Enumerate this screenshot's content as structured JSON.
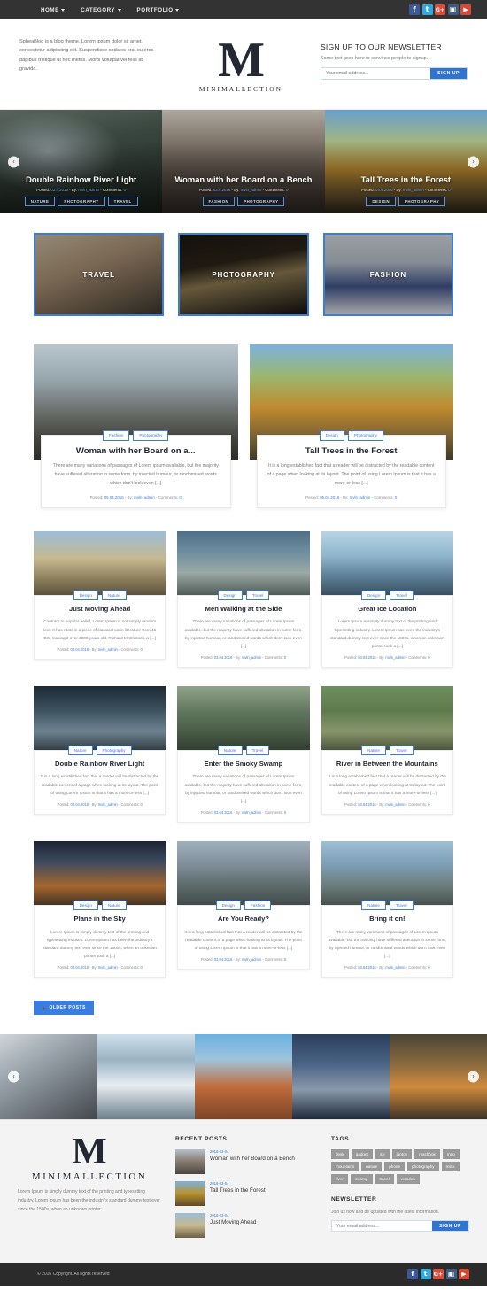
{
  "topnav": {
    "items": [
      {
        "label": "HOME",
        "icon": "chevron-down-icon"
      },
      {
        "label": "CATEGORY",
        "icon": "chevron-down-icon"
      },
      {
        "label": "PORTFOLIO",
        "icon": "chevron-down-icon"
      }
    ],
    "social": [
      {
        "name": "facebook-icon",
        "glyph": "f",
        "color": "#3b5998"
      },
      {
        "name": "twitter-icon",
        "glyph": "t",
        "color": "#2eaae0"
      },
      {
        "name": "google-plus-icon",
        "glyph": "G+",
        "color": "#dd4b39"
      },
      {
        "name": "instagram-icon",
        "glyph": "▣",
        "color": "#3f5d80"
      },
      {
        "name": "youtube-icon",
        "glyph": "▶",
        "color": "#d64937"
      }
    ]
  },
  "header": {
    "description": "SpheaBlog is a blog theme. Lorem ipsum dolor sit amet, consectetur adipiscing elit. Suspendisse sodales erat eu eros dapibus tristique ut nec metus. Morbi volutpat vel felis at gravida.",
    "brand_letter": "M",
    "brand_name": "MINIMALLECTION",
    "newsletter": {
      "title": "SIGN UP TO OUR NEWSLETTER",
      "subtitle": "Some text goes here to convince people to signup.",
      "placeholder": "Your email address...",
      "button": "SIGN UP"
    }
  },
  "slider": {
    "prev_icon": "‹",
    "next_icon": "›",
    "slides": [
      {
        "title": "Double Rainbow River Light",
        "meta_prefix": "Posted: ",
        "date": "03.4.2016",
        "by_prefix": " - By: ",
        "author": "mvln_admin",
        "comments_prefix": " - Comments: ",
        "comments": "0",
        "categories": [
          "NATURE",
          "PHOTOGRAPHY",
          "TRAVEL"
        ]
      },
      {
        "title": "Woman with her Board on a Bench",
        "meta_prefix": "Posted: ",
        "date": "03.4.2016",
        "by_prefix": " - By: ",
        "author": "mvln_admin",
        "comments_prefix": " - Comments: ",
        "comments": "0",
        "categories": [
          "FASHION",
          "PHOTOGRAPHY"
        ]
      },
      {
        "title": "Tall Trees in the Forest",
        "meta_prefix": "Posted: ",
        "date": "03.4.2016",
        "by_prefix": " - By: ",
        "author": "mvln_admin",
        "comments_prefix": " - Comments: ",
        "comments": "0",
        "categories": [
          "DESIGN",
          "PHOTOGRAPHY"
        ]
      }
    ]
  },
  "category_tiles": [
    {
      "label": "TRAVEL"
    },
    {
      "label": "PHOTOGRAPHY"
    },
    {
      "label": "FASHION"
    }
  ],
  "features": [
    {
      "chips": [
        "Fashion",
        "Photography"
      ],
      "title": "Woman with her Board on a...",
      "excerpt": "There are many variations of passages of Lorem ipsum available, but the majority have suffered alteration in some form, by injected humour, or randomised words which don't look even [...]",
      "meta_prefix": "Posted: ",
      "date": "05.04.2016",
      "by_prefix": " - By: ",
      "author": "mvln_admin",
      "comments_prefix": " - Comments: ",
      "comments": "0"
    },
    {
      "chips": [
        "Design",
        "Photography"
      ],
      "title": "Tall Trees in the Forest",
      "excerpt": "It is a long established fact that a reader will be distracted by the readable content of a page when looking at its layout. The point of using Lorem Ipsum is that it has a more-or-less [...]",
      "meta_prefix": "Posted: ",
      "date": "05.04.2016",
      "by_prefix": " - By: ",
      "author": "mvln_admin",
      "comments_prefix": " - Comments: ",
      "comments": "0"
    }
  ],
  "grid": [
    {
      "chips": [
        "Design",
        "Nature"
      ],
      "title": "Just Moving Ahead",
      "excerpt": "Contrary to popular belief, Lorem Ipsum is not simply random text. It has roots in a piece of classical Latin literature from 45 BC, making it over 2000 years old. Richard McClintock, a [...]",
      "meta_prefix": "Posted: ",
      "date": "03.04.2016",
      "by_prefix": " - By: ",
      "author": "mvln_admin",
      "comments_prefix": " - Comments: ",
      "comments": "0"
    },
    {
      "chips": [
        "Design",
        "Travel"
      ],
      "title": "Men Walking at the Side",
      "excerpt": "There are many variations of passages of Lorem Ipsum available, but the majority have suffered alteration in some form, by injected humour, or randomised words which don't look even [...]",
      "meta_prefix": "Posted: ",
      "date": "03.04.2016",
      "by_prefix": " - By: ",
      "author": "mvln_admin",
      "comments_prefix": " - Comments: ",
      "comments": "0"
    },
    {
      "chips": [
        "Design",
        "Travel"
      ],
      "title": "Great Ice Location",
      "excerpt": "Lorem Ipsum is simply dummy text of the printing and typesetting industry. Lorem Ipsum has been the industry's standard dummy text ever since the 1500s, when an unknown printer took a [...]",
      "meta_prefix": "Posted: ",
      "date": "03.04.2016",
      "by_prefix": " - By: ",
      "author": "mvln_admin",
      "comments_prefix": " - Comments: ",
      "comments": "0"
    },
    {
      "chips": [
        "Nature",
        "Photography"
      ],
      "title": "Double Rainbow River Light",
      "excerpt": "It is a long established fact that a reader will be distracted by the readable content of a page when looking at its layout. The point of using Lorem Ipsum is that it has a more-or-less [...]",
      "meta_prefix": "Posted: ",
      "date": "03.04.2016",
      "by_prefix": " - By: ",
      "author": "mvln_admin",
      "comments_prefix": " - Comments: ",
      "comments": "0"
    },
    {
      "chips": [
        "Nature",
        "Travel"
      ],
      "title": "Enter the Smoky Swamp",
      "excerpt": "There are many variations of passages of Lorem Ipsum available, but the majority have suffered alteration in some form, by injected humour, or randomised words which don't look even [...]",
      "meta_prefix": "Posted: ",
      "date": "03.04.2016",
      "by_prefix": " - By: ",
      "author": "mvln_admin",
      "comments_prefix": " - Comments: ",
      "comments": "0"
    },
    {
      "chips": [
        "Nature",
        "Travel"
      ],
      "title": "River in Between the Mountains",
      "excerpt": "It is a long established fact that a reader will be distracted by the readable content of a page when looking at its layout. The point of using Lorem Ipsum is that it has a more-or-less [...]",
      "meta_prefix": "Posted: ",
      "date": "03.04.2016",
      "by_prefix": " - By: ",
      "author": "mvln_admin",
      "comments_prefix": " - Comments: ",
      "comments": "0"
    },
    {
      "chips": [
        "Design",
        "Nature"
      ],
      "title": "Plane in the Sky",
      "excerpt": "Lorem Ipsum is simply dummy text of the printing and typesetting industry. Lorem Ipsum has been the industry's standard dummy text ever since the 1500s, when an unknown printer took a [...]",
      "meta_prefix": "Posted: ",
      "date": "03.04.2016",
      "by_prefix": " - By: ",
      "author": "mvln_admin",
      "comments_prefix": " - Comments: ",
      "comments": "0"
    },
    {
      "chips": [
        "Design",
        "Fashion"
      ],
      "title": "Are You Ready?",
      "excerpt": "It is a long established fact that a reader will be distracted by the readable content of a page when looking at its layout. The point of using Lorem Ipsum is that it has a more-or-less [...]",
      "meta_prefix": "Posted: ",
      "date": "03.04.2016",
      "by_prefix": " - By: ",
      "author": "mvln_admin",
      "comments_prefix": " - Comments: ",
      "comments": "0"
    },
    {
      "chips": [
        "Nature",
        "Travel"
      ],
      "title": "Bring it on!",
      "excerpt": "There are many variations of passages of Lorem Ipsum available, but the majority have suffered alteration in some form, by injected humour, or randomised words which don't look even [...]",
      "meta_prefix": "Posted: ",
      "date": "03.04.2016",
      "by_prefix": " - By: ",
      "author": "mvln_admin",
      "comments_prefix": " - Comments: ",
      "comments": "0"
    }
  ],
  "pagination": {
    "older_label": "OLDER POSTS",
    "older_icon": "➕"
  },
  "gallery": {
    "prev_icon": "‹",
    "next_icon": "›"
  },
  "footer": {
    "brand_letter": "M",
    "brand_name": "MINIMALLECTION",
    "about": "Lorem Ipsum is simply dummy text of the printing and typesetting industry. Lorem Ipsum has been the industry's standard dummy text ever since the 1500s, when an unknown printer",
    "recent_heading": "RECENT POSTS",
    "recent_posts": [
      {
        "date": "2016-03-04",
        "title": "Woman with her Board on a Bench"
      },
      {
        "date": "2016-03-04",
        "title": "Tall Trees in the Forest"
      },
      {
        "date": "2016-03-04",
        "title": "Just Moving Ahead"
      }
    ],
    "tags_heading": "TAGS",
    "tags": [
      "desk",
      "gadget",
      "ice",
      "laptop",
      "macbook",
      "map",
      "mountains",
      "nature",
      "phone",
      "photography",
      "relax",
      "river",
      "swamp",
      "travel",
      "wooden"
    ],
    "newsletter_heading": "NEWSLETTER",
    "newsletter_sub": "Join us now and be updated with the latest information.",
    "newsletter_placeholder": "Your email address...",
    "newsletter_button": "SIGN UP"
  },
  "copyright": {
    "text": "© 2016 Copyright. All rights reserved"
  },
  "colors": {
    "accent": "#3b7ddd",
    "dark": "#333333",
    "footer_bg": "#f3f3f3",
    "tag_bg": "#999999"
  }
}
